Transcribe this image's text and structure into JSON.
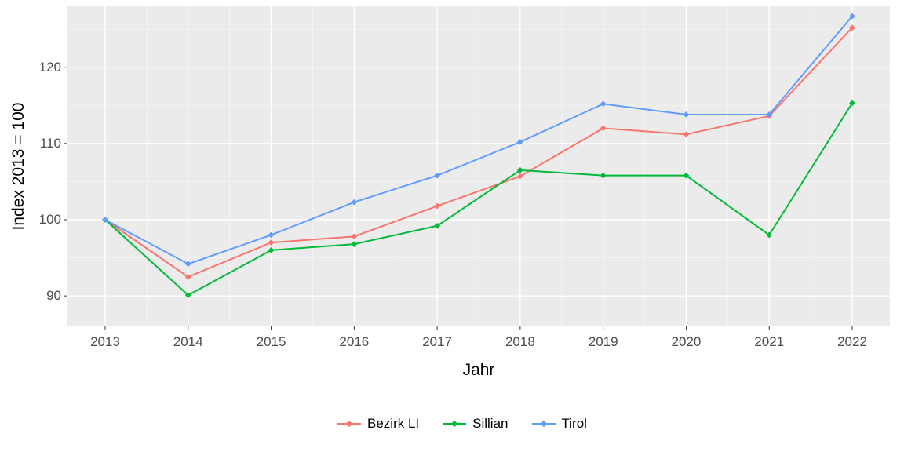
{
  "chart_data": {
    "type": "line",
    "xlabel": "Jahr",
    "ylabel": "Index  2013  = 100",
    "categories": [
      "2013",
      "2014",
      "2015",
      "2016",
      "2017",
      "2018",
      "2019",
      "2020",
      "2021",
      "2022"
    ],
    "y_ticks": [
      90,
      100,
      110,
      120
    ],
    "ylim": [
      86,
      128
    ],
    "series": [
      {
        "name": "Bezirk LI",
        "color": "#f8766d",
        "values": [
          100.0,
          92.5,
          97.0,
          97.8,
          101.8,
          105.7,
          112.0,
          111.2,
          113.6,
          125.2
        ]
      },
      {
        "name": "Sillian",
        "color": "#00ba38",
        "values": [
          100.0,
          90.1,
          96.0,
          96.8,
          99.2,
          106.5,
          105.8,
          105.8,
          98.0,
          115.3
        ]
      },
      {
        "name": "Tirol",
        "color": "#619cff",
        "values": [
          100.0,
          94.2,
          98.0,
          102.3,
          105.8,
          110.2,
          115.2,
          113.8,
          113.8,
          126.7
        ]
      }
    ]
  },
  "legend_labels": {
    "s0": "Bezirk LI",
    "s1": "Sillian",
    "s2": "Tirol"
  },
  "axis": {
    "x": "Jahr",
    "y": "Index  2013  = 100"
  }
}
